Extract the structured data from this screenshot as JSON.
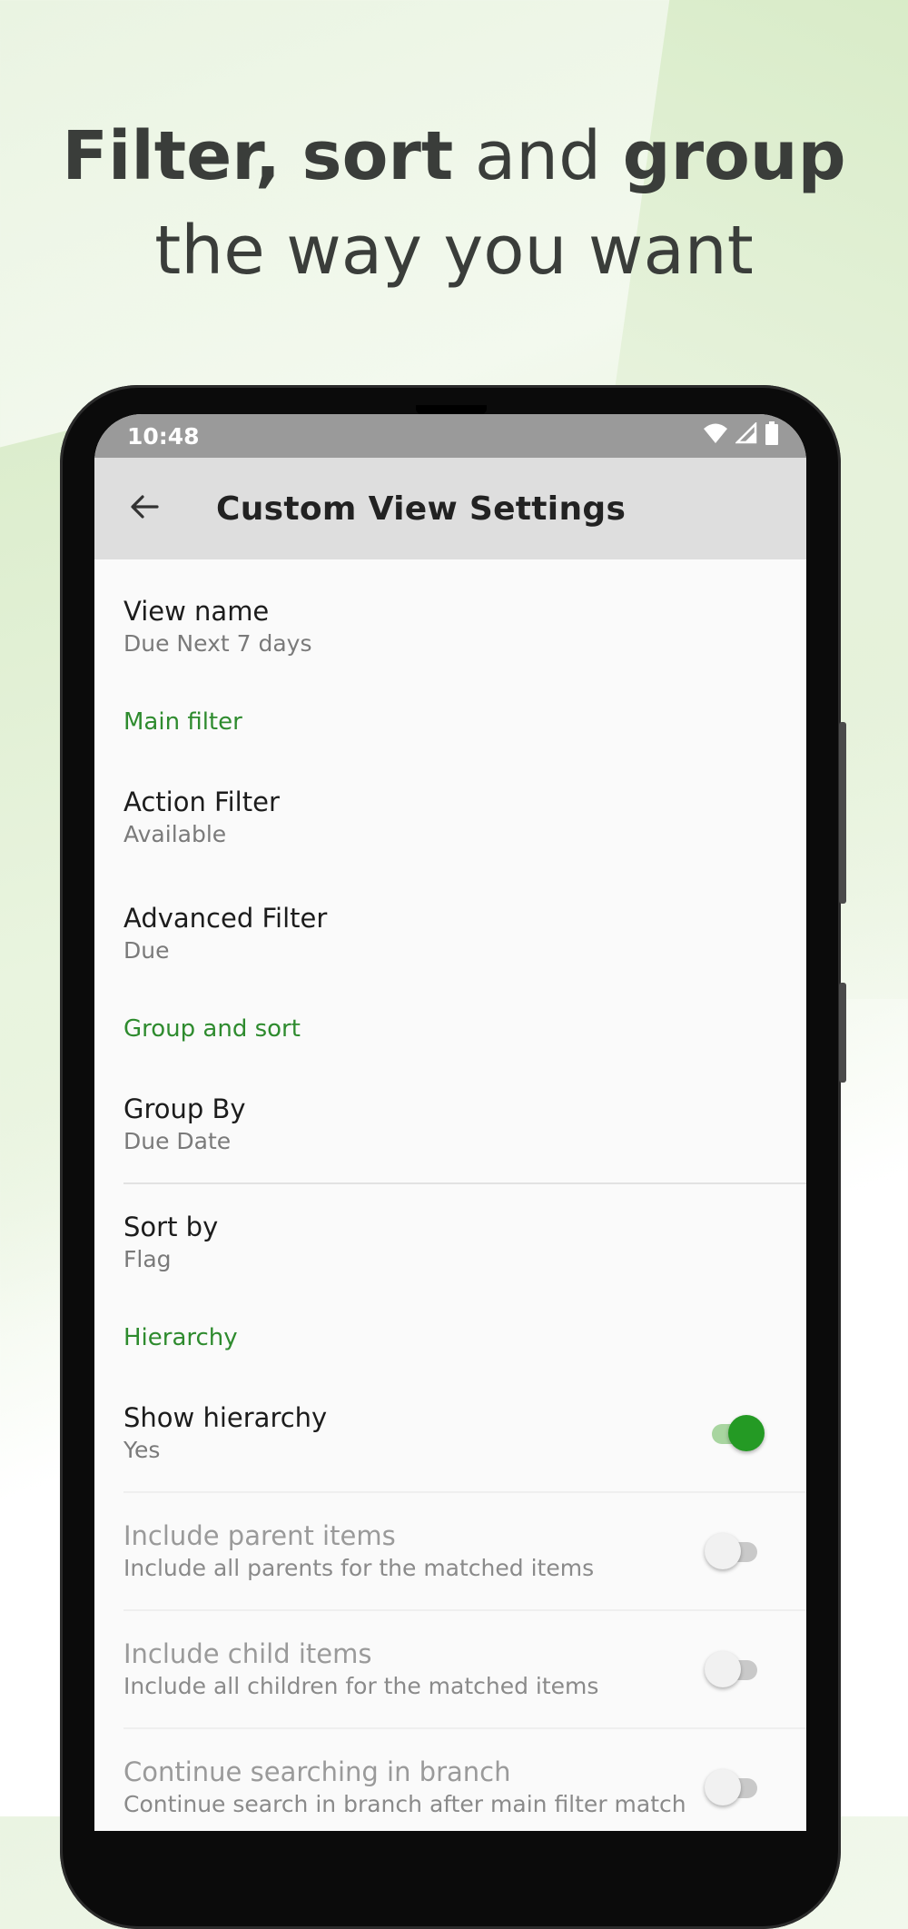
{
  "headline": {
    "line1_bold1": "Filter,",
    "line1_bold2": "sort",
    "line1_reg": "and",
    "line1_bold3": "group",
    "line2": "the way you want"
  },
  "status_bar": {
    "time": "10:48",
    "icons": [
      "wifi-icon",
      "signal-icon",
      "battery-icon"
    ]
  },
  "app_bar": {
    "title": "Custom View Settings",
    "back_icon": "arrow-left-icon"
  },
  "settings": {
    "view_name": {
      "title": "View name",
      "value": "Due Next 7 days"
    },
    "section_main_filter": "Main filter",
    "action_filter": {
      "title": "Action Filter",
      "value": "Available"
    },
    "advanced_filter": {
      "title": "Advanced Filter",
      "value": "Due"
    },
    "section_group_sort": "Group and sort",
    "group_by": {
      "title": "Group By",
      "value": "Due Date"
    },
    "sort_by": {
      "title": "Sort by",
      "value": "Flag"
    },
    "section_hierarchy": "Hierarchy",
    "show_hierarchy": {
      "title": "Show hierarchy",
      "value": "Yes",
      "checked": true
    },
    "include_parent": {
      "title": "Include parent items",
      "value": "Include all parents for the matched items",
      "checked": false
    },
    "include_child": {
      "title": "Include child items",
      "value": "Include all children for the matched items",
      "checked": false
    },
    "continue_search": {
      "title": "Continue searching in branch",
      "value": "Continue search in branch after main filter match",
      "checked": false
    }
  },
  "colors": {
    "accent": "#2e8b2e",
    "switch_on": "#249a24",
    "app_bar": "#dedede",
    "status_bar": "#9a9a9a"
  }
}
